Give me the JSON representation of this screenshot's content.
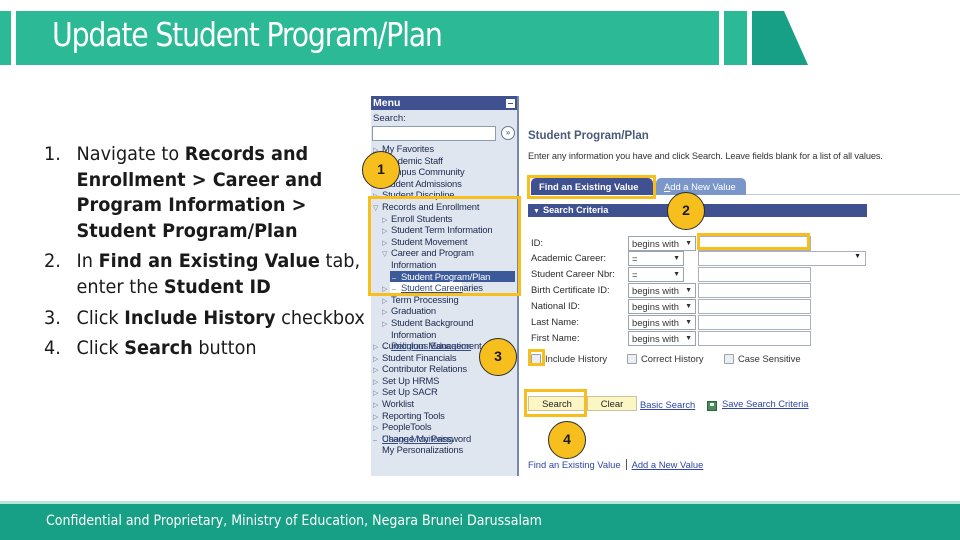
{
  "slide": {
    "title": "Update Student Program/Plan",
    "footer": "Confidential and Proprietary, Ministry of Education, Negara Brunei Darussalam",
    "colors": {
      "banner": "#2bb996",
      "banner_dark": "#17a085",
      "highlight": "#f6bf1e"
    }
  },
  "steps": [
    {
      "num": "1.",
      "parts": [
        {
          "t": "Navigate to ",
          "b": false
        },
        {
          "t": "Records and Enrollment > Career and Program Information > Student Program/Plan",
          "b": true
        }
      ]
    },
    {
      "num": "2.",
      "parts": [
        {
          "t": "In ",
          "b": false
        },
        {
          "t": "Find an Existing Value",
          "b": true
        },
        {
          "t": " tab, enter the ",
          "b": false
        },
        {
          "t": "Student ID",
          "b": true
        }
      ]
    },
    {
      "num": "3.",
      "parts": [
        {
          "t": "Click ",
          "b": false
        },
        {
          "t": "Include History",
          "b": true
        },
        {
          "t": " checkbox",
          "b": false
        }
      ]
    },
    {
      "num": "4.",
      "parts": [
        {
          "t": "Click ",
          "b": false
        },
        {
          "t": "Search",
          "b": true
        },
        {
          "t": " button",
          "b": false
        }
      ]
    }
  ],
  "callouts": [
    "1",
    "2",
    "3",
    "4"
  ],
  "menu": {
    "header": "Menu",
    "search_label": "Search:",
    "search_value": "",
    "go_icon": "»",
    "items": [
      {
        "label": "My Favorites",
        "level": 0,
        "icon": "▷",
        "state": "normal"
      },
      {
        "label": "Academic Staff",
        "level": 0,
        "icon": "▷",
        "state": "normal"
      },
      {
        "label": "Campus Community",
        "level": 0,
        "icon": "▷",
        "state": "normal"
      },
      {
        "label": "Student Admissions",
        "level": 0,
        "icon": "▷",
        "state": "normal"
      },
      {
        "label": "Student Discipline",
        "level": 0,
        "icon": "▷",
        "state": "normal"
      },
      {
        "label": "Records and Enrollment",
        "level": 0,
        "icon": "▽",
        "state": "expanded"
      },
      {
        "label": "Enroll Students",
        "level": 1,
        "icon": "▷",
        "state": "normal"
      },
      {
        "label": "Student Term Information",
        "level": 1,
        "icon": "▷",
        "state": "normal"
      },
      {
        "label": "Student Movement",
        "level": 1,
        "icon": "▷",
        "state": "normal"
      },
      {
        "label": "Career and Program",
        "level": 1,
        "icon": "▽",
        "state": "expanded"
      },
      {
        "label": "Information",
        "level": 1,
        "icon": "",
        "state": "continuation"
      },
      {
        "label": "Student Program/Plan",
        "level": 2,
        "icon": "–",
        "state": "selected"
      },
      {
        "label": "Student Career",
        "level": 2,
        "icon": "–",
        "state": "link"
      },
      {
        "label": "Enrollment Summaries",
        "level": 1,
        "icon": "▷",
        "state": "normal"
      },
      {
        "label": "Term Processing",
        "level": 1,
        "icon": "▷",
        "state": "normal"
      },
      {
        "label": "Graduation",
        "level": 1,
        "icon": "▷",
        "state": "normal"
      },
      {
        "label": "Student Background",
        "level": 1,
        "icon": "▷",
        "state": "normal"
      },
      {
        "label": "Information",
        "level": 1,
        "icon": "",
        "state": "continuation"
      },
      {
        "label": "Religious Education",
        "level": 1,
        "icon": "–",
        "state": "link"
      },
      {
        "label": "Curriculum Management",
        "level": 0,
        "icon": "▷",
        "state": "normal"
      },
      {
        "label": "Student Financials",
        "level": 0,
        "icon": "▷",
        "state": "normal"
      },
      {
        "label": "Contributor Relations",
        "level": 0,
        "icon": "▷",
        "state": "normal"
      },
      {
        "label": "Set Up HRMS",
        "level": 0,
        "icon": "▷",
        "state": "normal"
      },
      {
        "label": "Set Up SACR",
        "level": 0,
        "icon": "▷",
        "state": "normal"
      },
      {
        "label": "Worklist",
        "level": 0,
        "icon": "▷",
        "state": "normal"
      },
      {
        "label": "Reporting Tools",
        "level": 0,
        "icon": "▷",
        "state": "normal"
      },
      {
        "label": "PeopleTools",
        "level": 0,
        "icon": "▷",
        "state": "normal"
      },
      {
        "label": "Usage Monitoring",
        "level": 0,
        "icon": "–",
        "state": "link"
      },
      {
        "label": "Change My Password",
        "level": 0,
        "icon": "",
        "state": "plain"
      },
      {
        "label": "My Personalizations",
        "level": 0,
        "icon": "",
        "state": "plain"
      }
    ]
  },
  "search_page": {
    "title": "Student Program/Plan",
    "instructions": "Enter any information you have and click Search. Leave fields blank for a list of all values.",
    "tabs": {
      "active": "Find an Existing Value",
      "inactive_underlined": "A",
      "inactive_rest": "dd a New Value"
    },
    "criteria_header": "Search Criteria",
    "fields": [
      {
        "label": "ID:",
        "operator": "begins with",
        "value": "",
        "kind": "input"
      },
      {
        "label": "Academic Career:",
        "operator": "=",
        "value": "",
        "kind": "select"
      },
      {
        "label": "Student Career Nbr:",
        "operator": "=",
        "value": "",
        "kind": "input"
      },
      {
        "label": "Birth Certificate ID:",
        "operator": "begins with",
        "value": "",
        "kind": "input"
      },
      {
        "label": "National ID:",
        "operator": "begins with",
        "value": "",
        "kind": "input"
      },
      {
        "label": "Last Name:",
        "operator": "begins with",
        "value": "",
        "kind": "input"
      },
      {
        "label": "First Name:",
        "operator": "begins with",
        "value": "",
        "kind": "input"
      }
    ],
    "checkboxes": [
      {
        "label": "Include History",
        "checked": false
      },
      {
        "label": "Correct History",
        "checked": false
      },
      {
        "label": "Case Sensitive",
        "checked": false
      }
    ],
    "buttons": {
      "search": "Search",
      "clear": "Clear"
    },
    "links": {
      "basic_search": "Basic Search",
      "save_criteria": "Save Search Criteria",
      "find_existing": "Find an Existing Value",
      "add_new": "Add a New Value"
    }
  }
}
